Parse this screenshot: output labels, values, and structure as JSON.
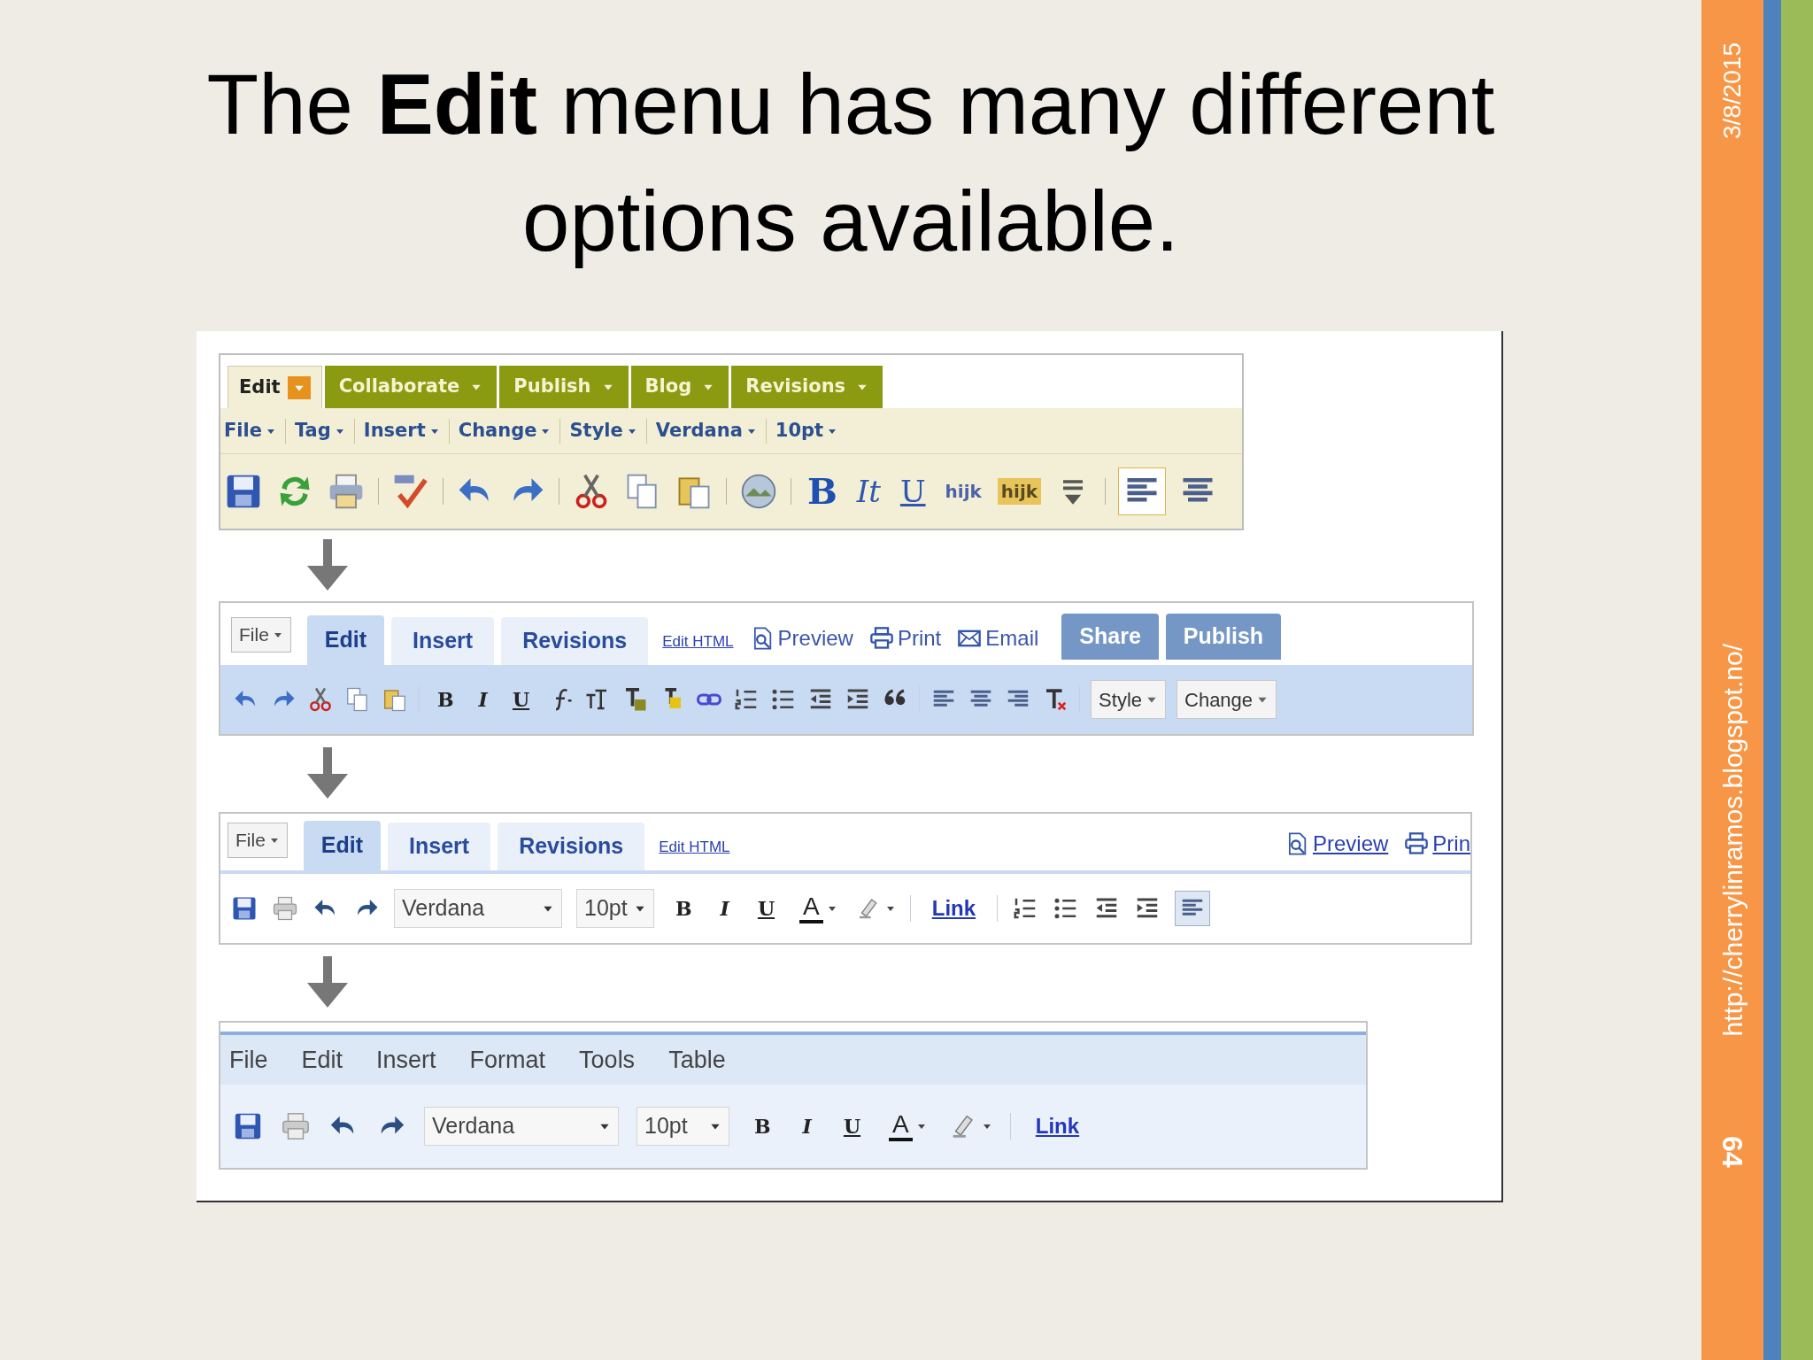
{
  "title": "The **Edit** menu has many different options available.",
  "editors": [
    {
      "kind": "classic",
      "tabs": [
        {
          "label": "Edit",
          "selected": true
        },
        {
          "label": "Collaborate",
          "selected": false
        },
        {
          "label": "Publish",
          "selected": false
        },
        {
          "label": "Blog",
          "selected": false
        },
        {
          "label": "Revisions",
          "selected": false
        }
      ],
      "menus": [
        "File",
        "Tag",
        "Insert",
        "Change",
        "Style",
        "Verdana",
        "10pt"
      ],
      "toolbar": [
        {
          "kind": "bold",
          "label": "B"
        },
        {
          "kind": "italic",
          "label": "It"
        },
        {
          "kind": "underline",
          "label": "U"
        },
        {
          "kind": "hijk",
          "label": "hijk"
        },
        {
          "kind": "hijk_highlight",
          "label": "hijk"
        }
      ],
      "left_align_active": true
    },
    {
      "kind": "tabbed",
      "file": "File",
      "tabs": [
        {
          "label": "Edit",
          "selected": true
        },
        {
          "label": "Insert",
          "selected": false
        },
        {
          "label": "Revisions",
          "selected": false
        }
      ],
      "link": "Edit HTML",
      "actions": [
        {
          "kind": "preview",
          "label": "Preview"
        },
        {
          "kind": "print",
          "label": "Print"
        },
        {
          "kind": "email",
          "label": "Email"
        }
      ],
      "buttons": [
        "Share",
        "Publish"
      ],
      "toolbar": [
        {
          "kind": "bold",
          "label": "B"
        },
        {
          "kind": "italic",
          "label": "I"
        },
        {
          "kind": "underline",
          "label": "U"
        },
        {
          "kind": "dropdown",
          "label": "Style"
        },
        {
          "kind": "dropdown",
          "label": "Change"
        }
      ]
    },
    {
      "kind": "tabbed_light",
      "file": "File",
      "tabs": [
        {
          "label": "Edit",
          "selected": true
        },
        {
          "label": "Insert",
          "selected": false
        },
        {
          "label": "Revisions",
          "selected": false
        }
      ],
      "link": "Edit HTML",
      "actions": [
        {
          "kind": "preview",
          "label": "Preview"
        },
        {
          "kind": "print",
          "label": "Prin"
        }
      ],
      "toolbar": [
        {
          "kind": "font_select",
          "label": "Verdana"
        },
        {
          "kind": "size_select",
          "label": "10pt"
        },
        {
          "kind": "bold",
          "label": "B"
        },
        {
          "kind": "italic",
          "label": "I"
        },
        {
          "kind": "underline",
          "label": "U"
        },
        {
          "kind": "color",
          "label": "A"
        },
        {
          "kind": "link",
          "label": "Link"
        }
      ],
      "left_align_active": true
    },
    {
      "kind": "menubar",
      "menus": [
        "File",
        "Edit",
        "Insert",
        "Format",
        "Tools",
        "Table"
      ],
      "toolbar": [
        {
          "kind": "font_select",
          "label": "Verdana"
        },
        {
          "kind": "size_select",
          "label": "10pt"
        },
        {
          "kind": "bold",
          "label": "B"
        },
        {
          "kind": "italic",
          "label": "I"
        },
        {
          "kind": "underline",
          "label": "U"
        },
        {
          "kind": "color",
          "label": "A"
        },
        {
          "kind": "link",
          "label": "Link"
        }
      ]
    }
  ],
  "sidebar": {
    "date": "3/8/2015",
    "url": "http://cherrylinramos.blogspot.no/",
    "page_number": "64"
  }
}
